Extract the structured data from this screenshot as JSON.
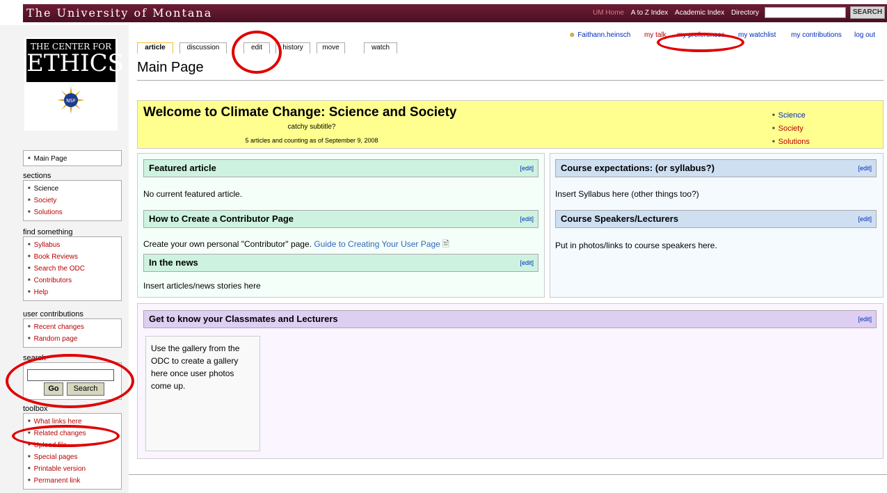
{
  "topbar": {
    "university": "The University of Montana",
    "nav": [
      "UM Home",
      "A to Z Index",
      "Academic Index",
      "Directory"
    ],
    "search_button": "SEARCH"
  },
  "logo": {
    "line1": "THE CENTER FOR",
    "line2": "ETHICS",
    "seal": "NSF"
  },
  "tabs": [
    "article",
    "discussion",
    "edit",
    "history",
    "move",
    "watch"
  ],
  "personal": {
    "user": "Faithann.heinsch",
    "items": [
      "my talk",
      "my preferences",
      "my watchlist",
      "my contributions",
      "log out"
    ]
  },
  "page_title": "Main Page",
  "welcome": {
    "title": "Welcome to Climate Change: Science and Society",
    "subtitle": "catchy subtitle?",
    "count": "5 articles and counting as of September 9, 2008",
    "links": [
      "Science",
      "Society",
      "Solutions"
    ]
  },
  "edit_label": "[edit]",
  "left_sections": [
    {
      "title": "Featured article",
      "body": "No current featured article."
    },
    {
      "title": "How to Create a Contributor Page",
      "body": "Create your own personal \"Contributor\" page.",
      "link": "Guide to Creating Your User Page"
    },
    {
      "title": "In the news",
      "body": "Insert articles/news stories here"
    }
  ],
  "right_sections": [
    {
      "title": "Course expectations: (or syllabus?)",
      "body": "Insert Syllabus here (other things too?)"
    },
    {
      "title": "Course Speakers/Lecturers",
      "body": "Put in photos/links to course speakers here."
    }
  ],
  "bottom_section": {
    "title": "Get to know your Classmates and Lecturers",
    "gallery_text": "Use the gallery from the ODC to create a gallery here once user photos come up."
  },
  "sidebar": {
    "mainpage": "Main Page",
    "sections": {
      "title": "sections",
      "items": [
        "Science",
        "Society",
        "Solutions"
      ]
    },
    "find": {
      "title": "find something",
      "items": [
        "Syllabus",
        "Book Reviews",
        "Search the ODC",
        "Contributors",
        "Help"
      ]
    },
    "contrib": {
      "title": "user contributions",
      "items": [
        "Recent changes",
        "Random page"
      ]
    },
    "search": {
      "title": "search",
      "go": "Go",
      "search": "Search"
    },
    "toolbox": {
      "title": "toolbox",
      "items": [
        "What links here",
        "Related changes",
        "Upload file",
        "Special pages",
        "Printable version",
        "Permanent link"
      ]
    }
  },
  "colors": {
    "banner": "#5a1429",
    "welcome_bg": "#ffff8f",
    "left_box_bg": "#f5fffa",
    "right_box_bg": "#f5faff",
    "bottom_box_bg": "#faf5ff",
    "annotation": "#e00000"
  }
}
